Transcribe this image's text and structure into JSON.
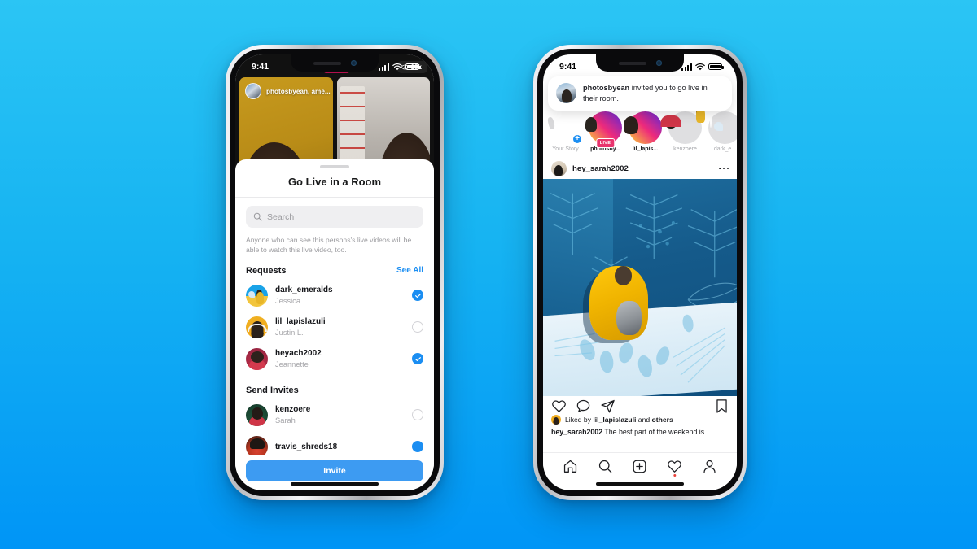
{
  "background": {
    "gradient_top": "#2bc5f4",
    "gradient_bottom": "#0095f6"
  },
  "left_phone": {
    "status_bar": {
      "time": "9:41"
    },
    "live_view": {
      "username_overlay": "photosbyean, ame...",
      "live_badge": "LIVE",
      "viewer_count": "18k"
    },
    "sheet": {
      "title": "Go Live in a Room",
      "search_placeholder": "Search",
      "description": "Anyone who can see this persons's live videos will be able to watch this live video, too.",
      "requests_section": {
        "title": "Requests",
        "see_all": "See All",
        "items": [
          {
            "username": "dark_emeralds",
            "name": "Jessica",
            "selected": true,
            "avatar": "av-dark"
          },
          {
            "username": "lil_lapislazuli",
            "name": "Justin L.",
            "selected": false,
            "avatar": "av-lil"
          },
          {
            "username": "heyach2002",
            "name": "Jeannette",
            "selected": true,
            "avatar": "av-hey"
          }
        ]
      },
      "invites_section": {
        "title": "Send Invites",
        "items": [
          {
            "username": "kenzoere",
            "name": "Sarah",
            "selected": false,
            "avatar": "av-ken"
          },
          {
            "username": "travis_shreds18",
            "name": "",
            "selected": true,
            "avatar": "av-tra"
          }
        ]
      },
      "invite_button": "Invite"
    }
  },
  "right_phone": {
    "status_bar": {
      "time": "9:41"
    },
    "notification": {
      "username": "photosbyean",
      "message": " invited you to go live in their room."
    },
    "stories": [
      {
        "label": "Your Story",
        "ring": "ring-plain",
        "img": "si-you",
        "has_plus": true,
        "live": false,
        "dim": false
      },
      {
        "label": "photosby...",
        "ring": "ring-grad",
        "img": "si-pho",
        "has_plus": false,
        "live": true,
        "live_label": "LIVE",
        "dim": false
      },
      {
        "label": "lil_lapis...",
        "ring": "ring-grad2",
        "img": "si-lil",
        "has_plus": false,
        "live": false,
        "dim": false
      },
      {
        "label": "kenzoere",
        "ring": "ring-gray",
        "img": "si-ken",
        "has_plus": false,
        "live": false,
        "dim": true
      },
      {
        "label": "dark_e...",
        "ring": "ring-gray",
        "img": "si-dar",
        "has_plus": false,
        "live": false,
        "dim": true
      }
    ],
    "post": {
      "username": "hey_sarah2002",
      "more_icon": "more-options-icon",
      "image_alt": "person in yellow raincoat with dog in front of blue palm mural",
      "actions": [
        "like-icon",
        "comment-icon",
        "share-icon",
        "bookmark-icon"
      ],
      "liked_by_prefix": "Liked by ",
      "liked_by_user": "lil_lapislazuli",
      "liked_by_mid": " and ",
      "liked_by_others": "others",
      "caption_user": "hey_sarah2002",
      "caption_text": " The best part of the weekend is"
    },
    "tab_bar": [
      "home-icon",
      "search-icon",
      "add-post-icon",
      "activity-icon",
      "profile-icon"
    ]
  }
}
